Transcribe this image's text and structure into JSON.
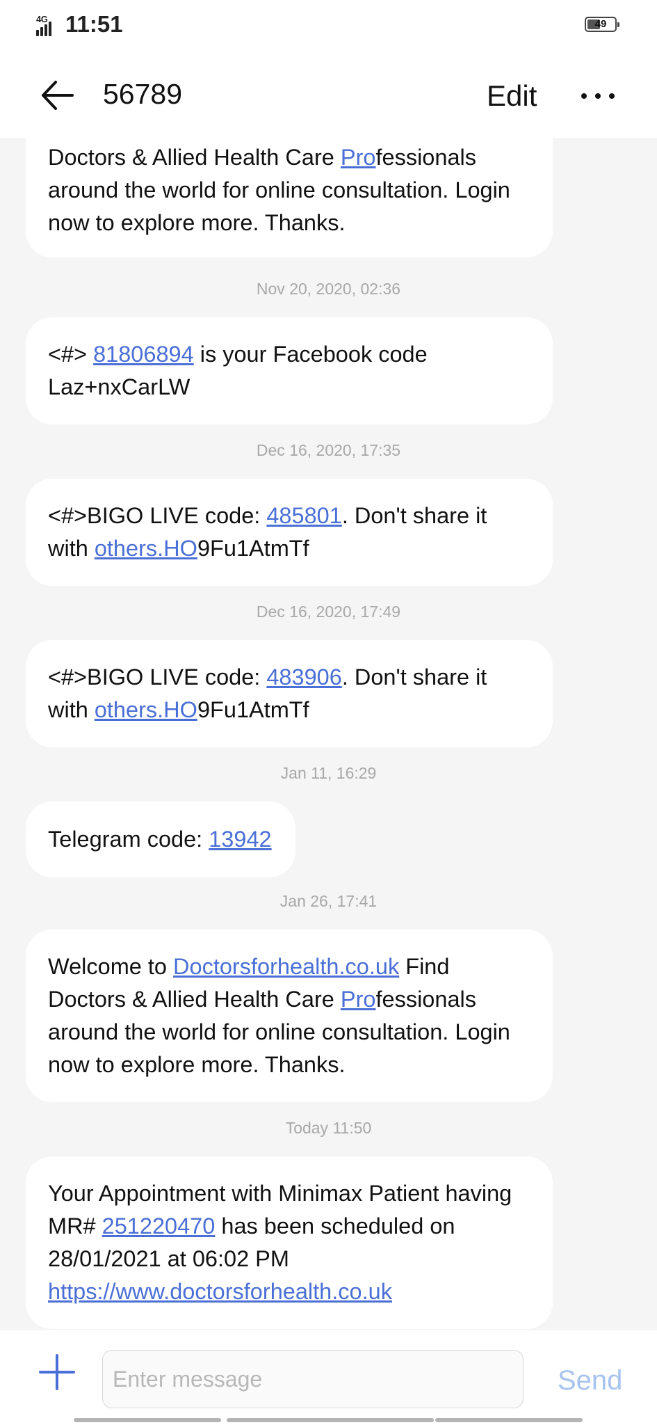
{
  "status_bar": {
    "network": "4G",
    "time": "11:51",
    "battery": "49"
  },
  "header": {
    "title": "56789",
    "edit_label": "Edit"
  },
  "messages": [
    {
      "parts": [
        "Doctors & Allied Health Care ",
        "Pro",
        "fessionals around the world for online consultation. Login now to explore more. Thanks."
      ]
    },
    {
      "timestamp": "Nov 20, 2020, 02:36",
      "parts": [
        "<#> ",
        "81806894",
        " is your Facebook code Laz+nxCarLW"
      ]
    },
    {
      "timestamp": "Dec 16, 2020, 17:35",
      "parts": [
        "<#>BIGO LIVE code: ",
        "485801",
        ". Don't share it with ",
        "others.HO",
        "9Fu1AtmTf"
      ]
    },
    {
      "timestamp": "Dec 16, 2020, 17:49",
      "parts": [
        "<#>BIGO LIVE code: ",
        "483906",
        ". Don't share it with ",
        "others.HO",
        "9Fu1AtmTf"
      ]
    },
    {
      "timestamp": "Jan 11, 16:29",
      "parts": [
        "Telegram code: ",
        "13942"
      ]
    },
    {
      "timestamp": "Jan 26, 17:41",
      "parts": [
        "Welcome to ",
        "Doctorsforhealth.co.uk",
        " Find Doctors & Allied Health Care ",
        "Pro",
        "fessionals around the world for online consultation. Login now to explore more. Thanks."
      ]
    },
    {
      "timestamp": "Today 11:50",
      "parts": [
        "Your Appointment with Minimax Patient having MR# ",
        "251220470",
        " has been scheduled on 28/01/2021 at 06:02 PM ",
        "https://www.doctorsforhealth.co.uk"
      ]
    }
  ],
  "composer": {
    "placeholder": "Enter message",
    "send_label": "Send"
  },
  "colors": {
    "link": "#4a6fd6",
    "send_disabled": "#a7c3ef",
    "timestamp": "#a8a8a8",
    "background": "#f5f5f5"
  }
}
